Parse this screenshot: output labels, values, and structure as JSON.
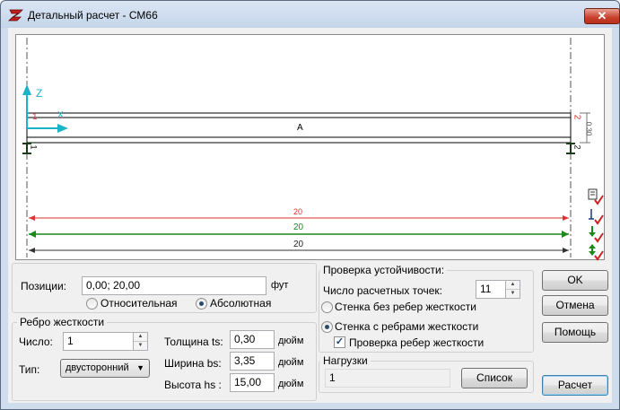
{
  "window": {
    "title": "Детальный расчет - СМ66",
    "close_glyph": "✕"
  },
  "drawing": {
    "axis_z": "Z",
    "axis_x": "X",
    "beam_label": "A",
    "node_left": "1",
    "node_right": "2",
    "end_marker_left": "1",
    "end_marker_right": "2",
    "depth": "0.30",
    "dim_red": "20",
    "dim_green": "20",
    "dim_black": "20",
    "colors": {
      "red": "#e03030",
      "green": "#1a8a1a",
      "cyan": "#1ab4c8"
    }
  },
  "positions": {
    "label": "Позиции:",
    "value": "0,00; 20,00",
    "unit": "фут",
    "relative": "Относительная",
    "absolute": "Абсолютная",
    "selected": "absolute"
  },
  "stiffener": {
    "title": "Ребро жесткости",
    "count_label": "Число:",
    "count_value": "1",
    "type_label": "Тип:",
    "type_value": "двусторонний",
    "thickness_label": "Толщина ts:",
    "thickness_value": "0,30",
    "width_label": "Ширина bs:",
    "width_value": "3,35",
    "height_label": "Высота hs :",
    "height_value": "15,00",
    "unit": "дюйм"
  },
  "stability": {
    "title": "Проверка устойчивости:",
    "points_label": "Число расчетных точек:",
    "points_value": "11",
    "no_ribs": "Стенка без ребер жесткости",
    "with_ribs": "Стенка с ребрами жесткости",
    "check_ribs": "Проверка ребер жесткости",
    "selected": "with_ribs",
    "check_ribs_checked": true
  },
  "loads": {
    "title": "Нагрузки",
    "value": "1",
    "list_button": "Список"
  },
  "buttons": {
    "ok": "OK",
    "cancel": "Отмена",
    "help": "Помощь",
    "calculate": "Расчет"
  },
  "side_icons": [
    "beam-check-icon",
    "support-check-icon",
    "load-check-icon",
    "stiffener-check-icon"
  ]
}
